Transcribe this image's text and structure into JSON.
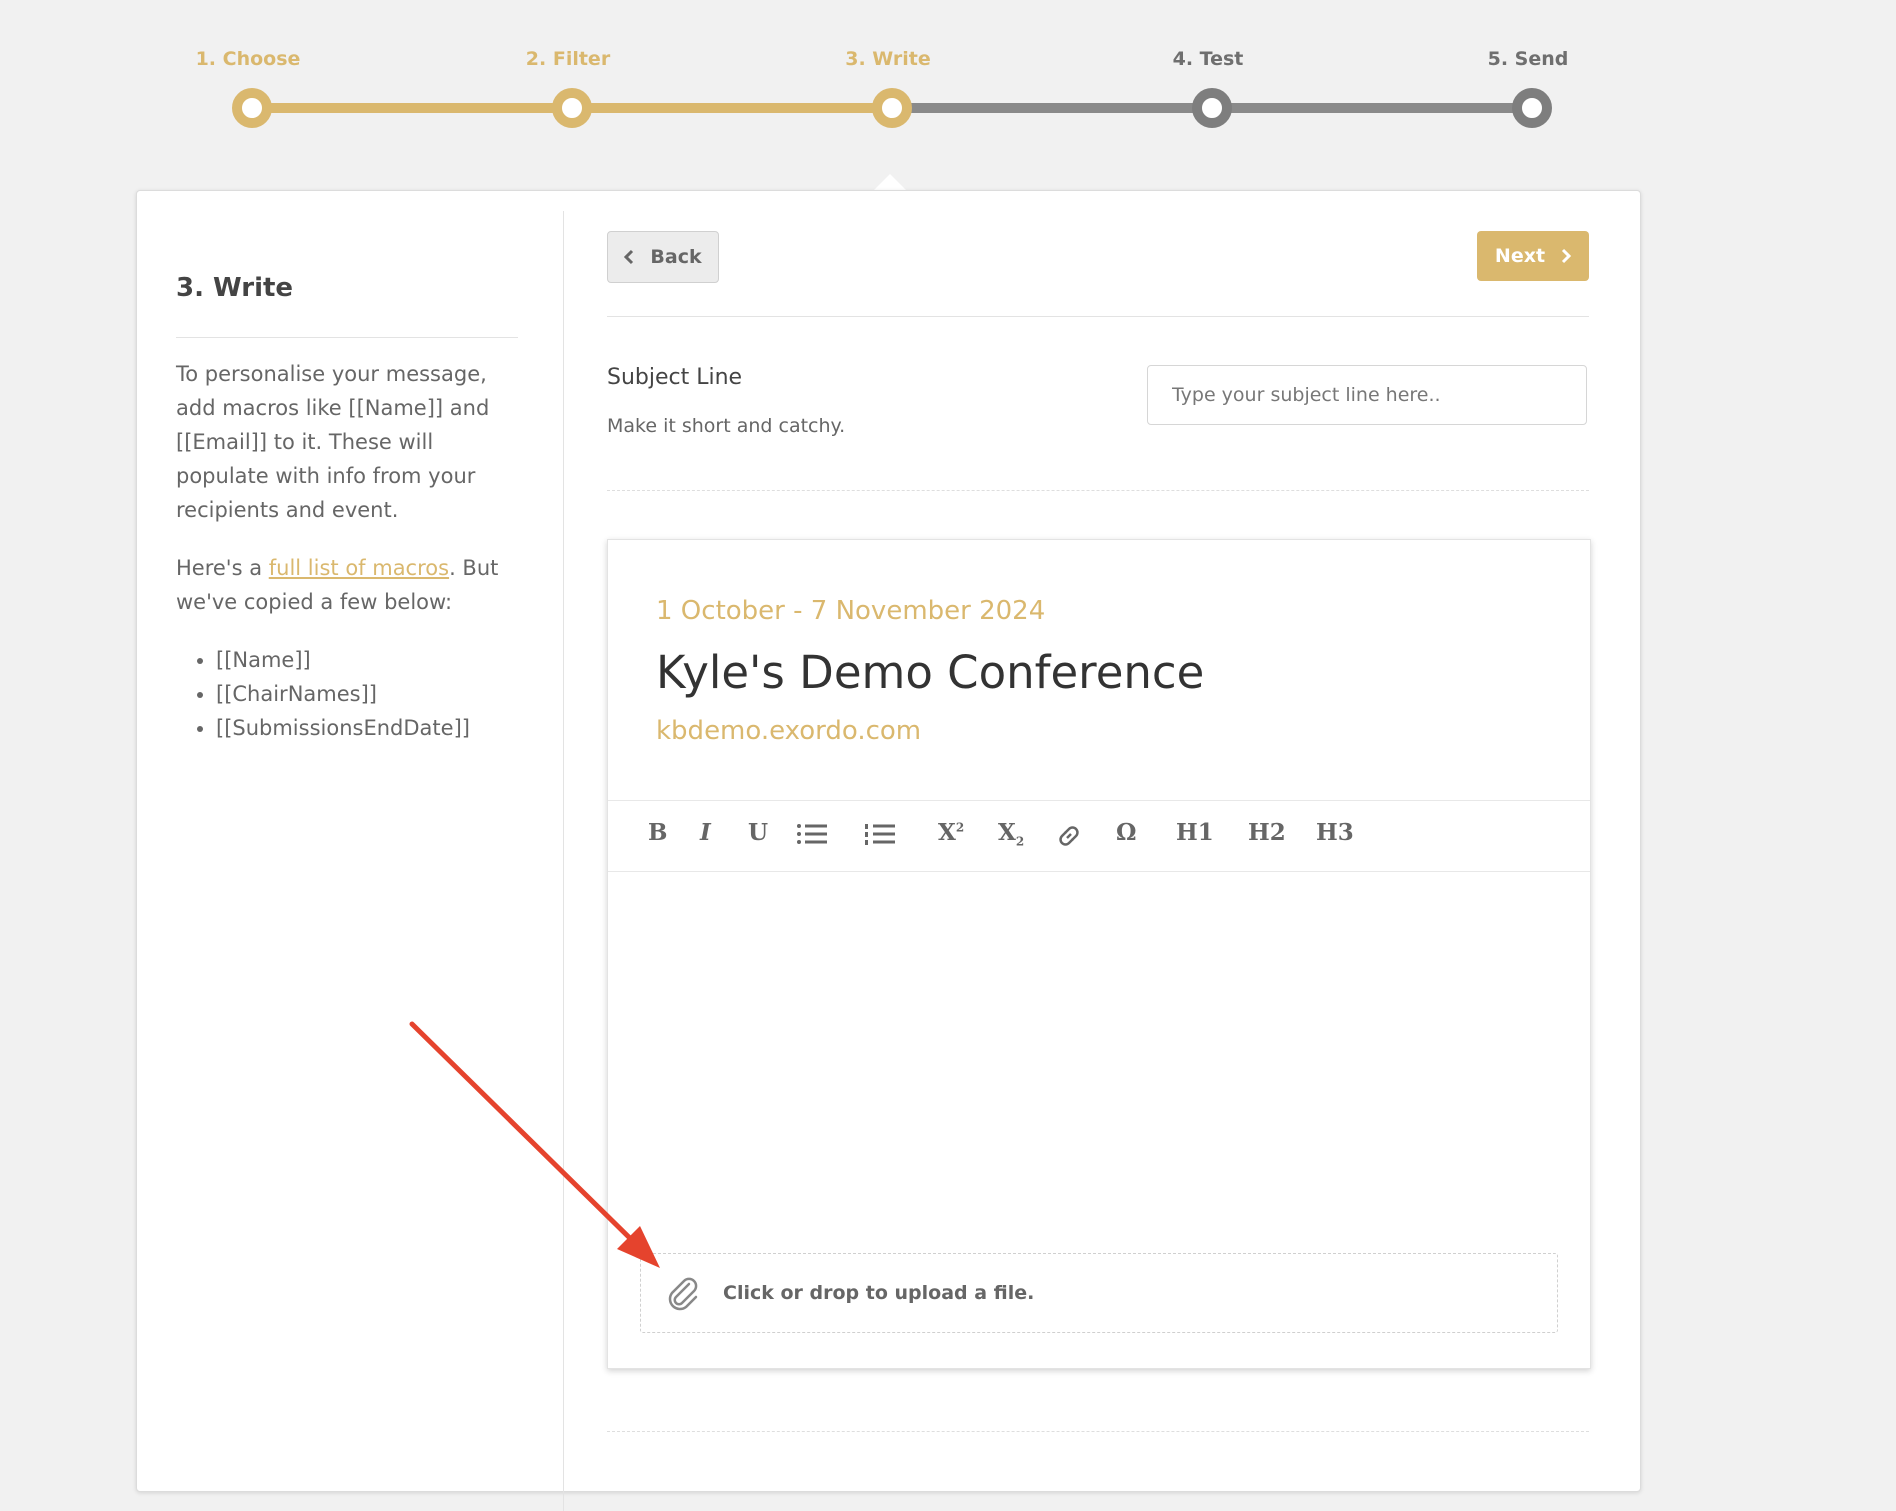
{
  "stepper": {
    "steps": [
      {
        "label": "1. Choose",
        "state": "done"
      },
      {
        "label": "2. Filter",
        "state": "done"
      },
      {
        "label": "3. Write",
        "state": "done"
      },
      {
        "label": "4. Test",
        "state": "todo"
      },
      {
        "label": "5. Send",
        "state": "todo"
      }
    ],
    "done_color": "#dab86e",
    "todo_color": "#8a8a8a"
  },
  "sidebar": {
    "title": "3. Write",
    "para1": "To personalise your message, add macros like [[Name]] and [[Email]] to it. These will populate with info from your recipients and event.",
    "para2_prefix": "Here's a ",
    "para2_link": "full list of macros",
    "para2_suffix": ". But we've copied a few below:",
    "macros": [
      "[[Name]]",
      "[[ChairNames]]",
      "[[SubmissionsEndDate]]"
    ]
  },
  "actions": {
    "back_label": "Back",
    "next_label": "Next"
  },
  "subject": {
    "label": "Subject Line",
    "hint": "Make it short and catchy.",
    "placeholder": "Type your subject line here..",
    "value": ""
  },
  "editor": {
    "dates": "1 October - 7 November 2024",
    "title": "Kyle's Demo Conference",
    "url": "kbdemo.exordo.com",
    "toolbar": {
      "bold": "B",
      "italic": "I",
      "underline": "U",
      "superscript": "X",
      "superscript_mark": "2",
      "subscript": "X",
      "subscript_mark": "2",
      "omega": "Ω",
      "h1": "H1",
      "h2": "H2",
      "h3": "H3"
    },
    "upload_text": "Click or drop to upload a file."
  },
  "colors": {
    "accent": "#dab86e",
    "annotation": "#e5432d"
  }
}
